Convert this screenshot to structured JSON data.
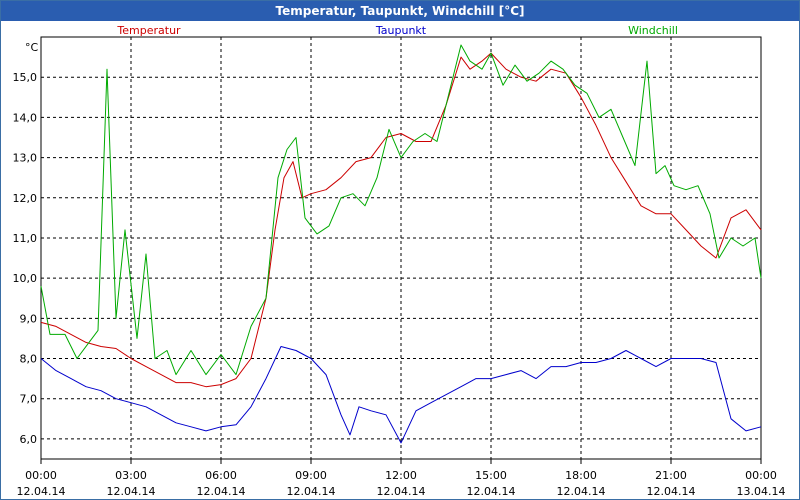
{
  "window": {
    "title": "Temperatur, Taupunkt, Windchill [°C]"
  },
  "chart_data": {
    "type": "line",
    "title": "Temperatur, Taupunkt, Windchill [°C]",
    "ylabel": "°C",
    "xlabel": "",
    "ylim": [
      5.5,
      16.0
    ],
    "xlim": [
      0,
      24
    ],
    "grid": true,
    "legend_position": "top",
    "y_ticks": [
      "6,0",
      "7,0",
      "8,0",
      "9,0",
      "10,0",
      "11,0",
      "12,0",
      "13,0",
      "14,0",
      "15,0"
    ],
    "x_ticks": [
      {
        "time": "00:00",
        "date": "12.04.14"
      },
      {
        "time": "03:00",
        "date": "12.04.14"
      },
      {
        "time": "06:00",
        "date": "12.04.14"
      },
      {
        "time": "09:00",
        "date": "12.04.14"
      },
      {
        "time": "12:00",
        "date": "12.04.14"
      },
      {
        "time": "15:00",
        "date": "12.04.14"
      },
      {
        "time": "18:00",
        "date": "12.04.14"
      },
      {
        "time": "21:00",
        "date": "12.04.14"
      },
      {
        "time": "00:00",
        "date": "13.04.14"
      }
    ],
    "series": [
      {
        "name": "Temperatur",
        "color": "#cc0000",
        "points": [
          [
            0,
            8.9
          ],
          [
            0.5,
            8.8
          ],
          [
            1,
            8.6
          ],
          [
            1.5,
            8.4
          ],
          [
            2,
            8.3
          ],
          [
            2.5,
            8.25
          ],
          [
            3,
            8.0
          ],
          [
            3.5,
            7.8
          ],
          [
            4,
            7.6
          ],
          [
            4.5,
            7.4
          ],
          [
            5,
            7.4
          ],
          [
            5.5,
            7.3
          ],
          [
            6,
            7.35
          ],
          [
            6.5,
            7.5
          ],
          [
            7,
            8.0
          ],
          [
            7.5,
            9.5
          ],
          [
            7.8,
            11.2
          ],
          [
            8.1,
            12.5
          ],
          [
            8.4,
            12.9
          ],
          [
            8.7,
            12.0
          ],
          [
            9,
            12.1
          ],
          [
            9.5,
            12.2
          ],
          [
            10,
            12.5
          ],
          [
            10.5,
            12.9
          ],
          [
            11,
            13.0
          ],
          [
            11.5,
            13.5
          ],
          [
            12,
            13.6
          ],
          [
            12.5,
            13.4
          ],
          [
            13,
            13.4
          ],
          [
            13.5,
            14.3
          ],
          [
            14,
            15.5
          ],
          [
            14.3,
            15.2
          ],
          [
            14.7,
            15.4
          ],
          [
            15,
            15.6
          ],
          [
            15.5,
            15.2
          ],
          [
            16,
            15.0
          ],
          [
            16.5,
            14.9
          ],
          [
            17,
            15.2
          ],
          [
            17.5,
            15.1
          ],
          [
            18,
            14.5
          ],
          [
            18.5,
            13.8
          ],
          [
            19,
            13.0
          ],
          [
            19.5,
            12.4
          ],
          [
            20,
            11.8
          ],
          [
            20.5,
            11.6
          ],
          [
            21,
            11.6
          ],
          [
            21.5,
            11.2
          ],
          [
            22,
            10.8
          ],
          [
            22.5,
            10.5
          ],
          [
            23,
            11.5
          ],
          [
            23.5,
            11.7
          ],
          [
            24,
            11.2
          ]
        ]
      },
      {
        "name": "Taupunkt",
        "color": "#0000cc",
        "points": [
          [
            0,
            8.0
          ],
          [
            0.5,
            7.7
          ],
          [
            1,
            7.5
          ],
          [
            1.5,
            7.3
          ],
          [
            2,
            7.2
          ],
          [
            2.5,
            7.0
          ],
          [
            3,
            6.9
          ],
          [
            3.5,
            6.8
          ],
          [
            4,
            6.6
          ],
          [
            4.5,
            6.4
          ],
          [
            5,
            6.3
          ],
          [
            5.5,
            6.2
          ],
          [
            6,
            6.3
          ],
          [
            6.5,
            6.35
          ],
          [
            7,
            6.8
          ],
          [
            7.5,
            7.5
          ],
          [
            8,
            8.3
          ],
          [
            8.5,
            8.2
          ],
          [
            9,
            8.0
          ],
          [
            9.5,
            7.6
          ],
          [
            10,
            6.6
          ],
          [
            10.3,
            6.1
          ],
          [
            10.6,
            6.8
          ],
          [
            11,
            6.7
          ],
          [
            11.5,
            6.6
          ],
          [
            12,
            5.9
          ],
          [
            12.5,
            6.7
          ],
          [
            13,
            6.9
          ],
          [
            13.5,
            7.1
          ],
          [
            14,
            7.3
          ],
          [
            14.5,
            7.5
          ],
          [
            15,
            7.5
          ],
          [
            15.5,
            7.6
          ],
          [
            16,
            7.7
          ],
          [
            16.5,
            7.5
          ],
          [
            17,
            7.8
          ],
          [
            17.5,
            7.8
          ],
          [
            18,
            7.9
          ],
          [
            18.5,
            7.9
          ],
          [
            19,
            8.0
          ],
          [
            19.5,
            8.2
          ],
          [
            20,
            8.0
          ],
          [
            20.5,
            7.8
          ],
          [
            21,
            8.0
          ],
          [
            21.5,
            8.0
          ],
          [
            22,
            8.0
          ],
          [
            22.5,
            7.9
          ],
          [
            23,
            6.5
          ],
          [
            23.5,
            6.2
          ],
          [
            24,
            6.3
          ]
        ]
      },
      {
        "name": "Windchill",
        "color": "#00aa00",
        "points": [
          [
            0,
            9.8
          ],
          [
            0.3,
            8.6
          ],
          [
            0.8,
            8.6
          ],
          [
            1.2,
            8.0
          ],
          [
            1.6,
            8.4
          ],
          [
            1.9,
            8.7
          ],
          [
            2.2,
            15.2
          ],
          [
            2.5,
            9.0
          ],
          [
            2.8,
            11.2
          ],
          [
            3.2,
            8.5
          ],
          [
            3.5,
            10.6
          ],
          [
            3.8,
            8.0
          ],
          [
            4.2,
            8.2
          ],
          [
            4.5,
            7.6
          ],
          [
            5,
            8.2
          ],
          [
            5.5,
            7.6
          ],
          [
            6,
            8.1
          ],
          [
            6.5,
            7.6
          ],
          [
            7,
            8.8
          ],
          [
            7.5,
            9.5
          ],
          [
            7.9,
            12.5
          ],
          [
            8.2,
            13.2
          ],
          [
            8.5,
            13.5
          ],
          [
            8.8,
            11.5
          ],
          [
            9.2,
            11.1
          ],
          [
            9.6,
            11.3
          ],
          [
            10,
            12.0
          ],
          [
            10.4,
            12.1
          ],
          [
            10.8,
            11.8
          ],
          [
            11.2,
            12.5
          ],
          [
            11.6,
            13.7
          ],
          [
            12,
            13.0
          ],
          [
            12.4,
            13.4
          ],
          [
            12.8,
            13.6
          ],
          [
            13.2,
            13.4
          ],
          [
            13.6,
            14.6
          ],
          [
            14,
            15.8
          ],
          [
            14.3,
            15.4
          ],
          [
            14.7,
            15.2
          ],
          [
            15,
            15.6
          ],
          [
            15.4,
            14.8
          ],
          [
            15.8,
            15.3
          ],
          [
            16.2,
            14.9
          ],
          [
            16.6,
            15.1
          ],
          [
            17,
            15.4
          ],
          [
            17.4,
            15.2
          ],
          [
            17.8,
            14.8
          ],
          [
            18.2,
            14.6
          ],
          [
            18.6,
            14.0
          ],
          [
            19,
            14.2
          ],
          [
            19.4,
            13.5
          ],
          [
            19.8,
            12.8
          ],
          [
            20.2,
            15.4
          ],
          [
            20.5,
            12.6
          ],
          [
            20.8,
            12.8
          ],
          [
            21.1,
            12.3
          ],
          [
            21.5,
            12.2
          ],
          [
            21.9,
            12.3
          ],
          [
            22.3,
            11.6
          ],
          [
            22.6,
            10.5
          ],
          [
            23,
            11.0
          ],
          [
            23.4,
            10.8
          ],
          [
            23.8,
            11.0
          ],
          [
            24,
            10.0
          ]
        ]
      }
    ]
  }
}
